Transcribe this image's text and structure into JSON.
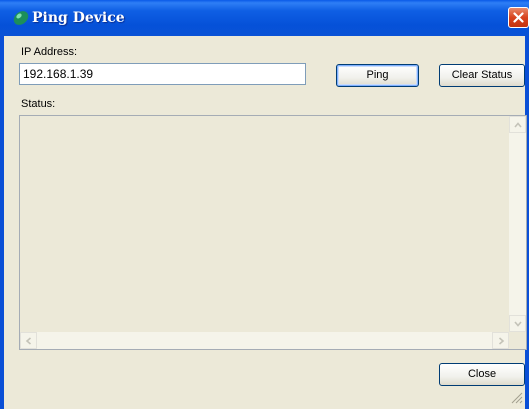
{
  "window": {
    "title": "Ping Device",
    "app_icon": "network-orb-icon",
    "close_icon": "close-icon"
  },
  "form": {
    "ip_label": "IP Address:",
    "ip_value": "192.168.1.39",
    "ping_label": "Ping",
    "clear_label": "Clear Status",
    "status_label": "Status:",
    "status_text": "",
    "close_label": "Close"
  },
  "colors": {
    "titlebar": "#0551d8",
    "face": "#ece9d8",
    "close_button": "#d8431e",
    "input_border": "#7f9db9"
  }
}
